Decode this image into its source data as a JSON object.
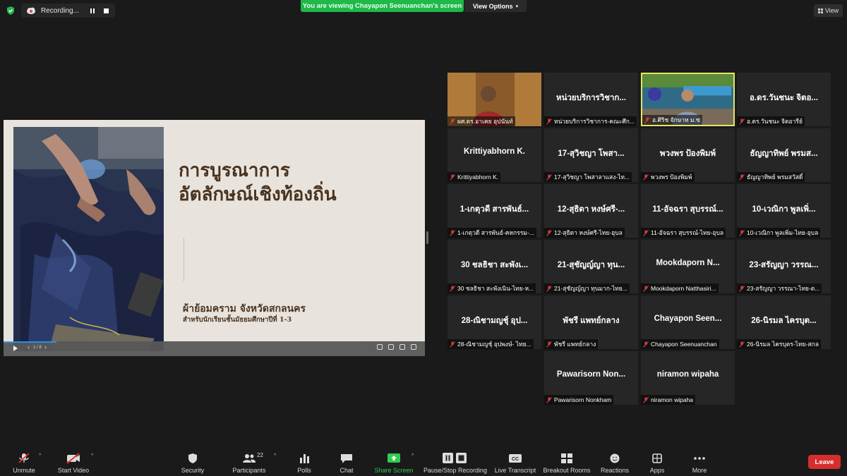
{
  "top_bar": {
    "recording_label": "Recording...",
    "viewing_banner": "You are viewing Chayapon Seenuanchan's screen",
    "view_options_label": "View Options",
    "view_label": "View"
  },
  "colors": {
    "banner_green": "#1fb84a",
    "active_speaker_border": "#e2e46a",
    "leave_red": "#d62d2d",
    "share_screen_green": "#2ecc52"
  },
  "shared_slide": {
    "title_line1": "การบูรณาการ",
    "title_line2": "อัตลักษณ์เชิงท้องถิ่น",
    "subtitle": "ผ้าย้อมคราม จังหวัดสกลนคร",
    "subtitle2": "สำหรับนักเรียนชั้นมัธยมศึกษาปีที่ 1-3",
    "page_indicator": "1 / 8"
  },
  "participants": [
    {
      "big": "",
      "label": "ผศ.ดร.อาเคย อุปนันท์",
      "video": true
    },
    {
      "big": "หน่วยบริการวิชาก...",
      "label": "หน่วยบริการวิชาการ-คณะศึก...",
      "video": false
    },
    {
      "big": "",
      "label": "อ.ศิริช จักษาห ม.ซ",
      "video": true,
      "active": true
    },
    {
      "big": "อ.ดร.วันชนะ จิตอ...",
      "label": "อ.ดร.วันชนะ จิตอารีย์",
      "video": false
    },
    {
      "big": "Krittiyabhorn K.",
      "label": "Krittiyabhorn K.",
      "video": false
    },
    {
      "big": "17-สุวิชญา โพสา...",
      "label": "17-สุวิชญา โพสาลาแสง-ไท...",
      "video": false
    },
    {
      "big": "พวงพร ป้องพิมพ์",
      "label": "พวงพร ป้องพิมพ์",
      "video": false
    },
    {
      "big": "ธัญญาทิพย์ พรมส...",
      "label": "ธัญญาทิพย์ พรมสวัสดิ์",
      "video": false
    },
    {
      "big": "1-เกตุวดี สารพันธ์...",
      "label": "1-เกตุวดี สารพันธ์-คหกรรม-...",
      "video": false
    },
    {
      "big": "12-สุธิดา หงษ์ศรี-...",
      "label": "12-สุธิดา หงษ์ศรี-ไทย-อุบล",
      "video": false
    },
    {
      "big": "11-อัจฉรา สุบรรณ์...",
      "label": "11-อัจฉรา สุบรรณ์-ไทย-อุบล",
      "video": false
    },
    {
      "big": "10-เวณิกา พูลเพิ่...",
      "label": "10-เวณิกา พูลเพิ่ม-ไทย-อุบล",
      "video": false
    },
    {
      "big": "30 ชลธิชา สะพังเ...",
      "label": "30 ชลธิชา สะพังเนิน-ไทย-ห...",
      "video": false
    },
    {
      "big": "21-สุชัญญ์ญา ทุน...",
      "label": "21-สุชัญญ์ญา ทุนมาก-ไทย...",
      "video": false
    },
    {
      "big": "Mookdaporn  N...",
      "label": "Mookdaporn Natthasiri...",
      "video": false
    },
    {
      "big": "23-สรัญญา วรรณ...",
      "label": "23-สรัญญา วรรณา-ไทย-ต...",
      "video": false
    },
    {
      "big": "28-ณิชามญชุ์ อุป...",
      "label": "28-ณิชามญชุ์ อุปพงษ์- ไทย...",
      "video": false
    },
    {
      "big": "พัชรี แพทย์กลาง",
      "label": "พัชรี แพทย์กลาง",
      "video": false
    },
    {
      "big": "Chayapon  Seen...",
      "label": "Chayapon Seenuanchan",
      "video": false
    },
    {
      "big": "26-นิรมล ไครบุต...",
      "label": "26-นิรมล ไครบุตร-ไทย-สกล",
      "video": false
    },
    {
      "big": "Pawarisorn  Non...",
      "label": "Pawarisorn Nonkham",
      "video": false
    },
    {
      "big": "niramon wipaha",
      "label": "niramon wipaha",
      "video": false
    }
  ],
  "toolbar": {
    "unmute": "Unmute",
    "start_video": "Start Video",
    "security": "Security",
    "participants": "Participants",
    "participants_count": "22",
    "polls": "Polls",
    "chat": "Chat",
    "share_screen": "Share Screen",
    "pause_stop": "Pause/Stop Recording",
    "live_transcript": "Live Transcript",
    "breakout": "Breakout Rooms",
    "reactions": "Reactions",
    "apps": "Apps",
    "more": "More",
    "leave": "Leave"
  }
}
